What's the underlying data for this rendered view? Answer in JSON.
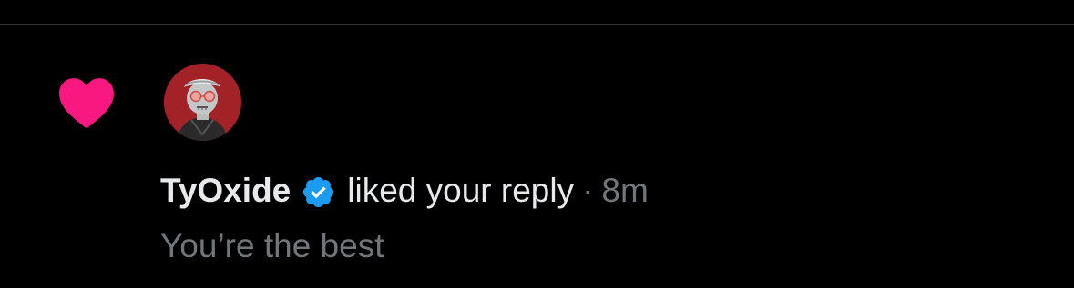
{
  "notification": {
    "type_icon": "heart-icon",
    "type_icon_color": "#f91880",
    "avatar": {
      "icon": "user-avatar-icon",
      "background_color": "#a32228"
    },
    "username": "TyOxide",
    "verified_icon": "verified-badge-icon",
    "verified_color": "#1d9bf0",
    "action_text": "liked your reply",
    "separator": "·",
    "time_ago": "8m",
    "reply_text": "You’re the best"
  },
  "colors": {
    "background": "#000000",
    "primary_text": "#e7e9ea",
    "secondary_text": "#71767b",
    "divider": "#2f3336"
  }
}
